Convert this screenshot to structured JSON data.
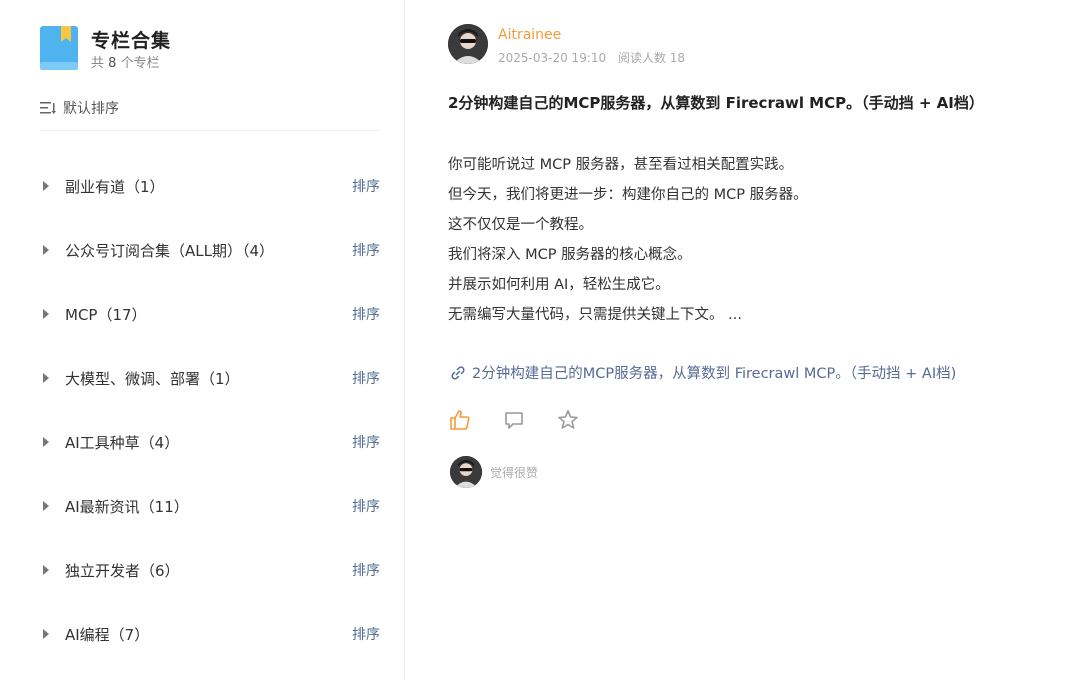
{
  "collection": {
    "title": "专栏合集",
    "count_prefix": "共",
    "count": "8",
    "count_suffix": "个专栏",
    "sort_label": "默认排序",
    "items": [
      {
        "label": "副业有道（1）",
        "action": "排序"
      },
      {
        "label": "公众号订阅合集（ALL期）（4）",
        "action": "排序"
      },
      {
        "label": "MCP（17）",
        "action": "排序"
      },
      {
        "label": "大模型、微调、部署（1）",
        "action": "排序"
      },
      {
        "label": "AI工具种草（4）",
        "action": "排序"
      },
      {
        "label": "AI最新资讯（11）",
        "action": "排序"
      },
      {
        "label": "独立开发者（6）",
        "action": "排序"
      },
      {
        "label": "AI编程（7）",
        "action": "排序"
      }
    ]
  },
  "post": {
    "author": "Aitrainee",
    "datetime": "2025-03-20 19:10",
    "read_label": "阅读人数 18",
    "title": "2分钟构建自己的MCP服务器，从算数到 Firecrawl MCP。（手动挡 + AI档）",
    "body": [
      "你可能听说过 MCP 服务器，甚至看过相关配置实践。",
      "但今天，我们将更进一步：构建你自己的 MCP 服务器。",
      "这不仅仅是一个教程。",
      "我们将深入 MCP 服务器的核心概念。",
      "并展示如何利用 AI，轻松生成它。",
      "无需编写大量代码，只需提供关键上下文。 ..."
    ],
    "link_text": "2分钟构建自己的MCP服务器，从算数到 Firecrawl MCP。（手动挡 + AI档)",
    "liked_text": "觉得很赞"
  },
  "colors": {
    "accent_orange": "#f59a3c",
    "link_blue": "#576b95",
    "book_blue": "#4fb3f0",
    "book_yellow": "#f7c744"
  },
  "icons": [
    "book-icon",
    "sort-lines-icon",
    "triangle-right-icon",
    "link-icon",
    "thumbs-up-icon",
    "comment-icon",
    "star-icon"
  ]
}
